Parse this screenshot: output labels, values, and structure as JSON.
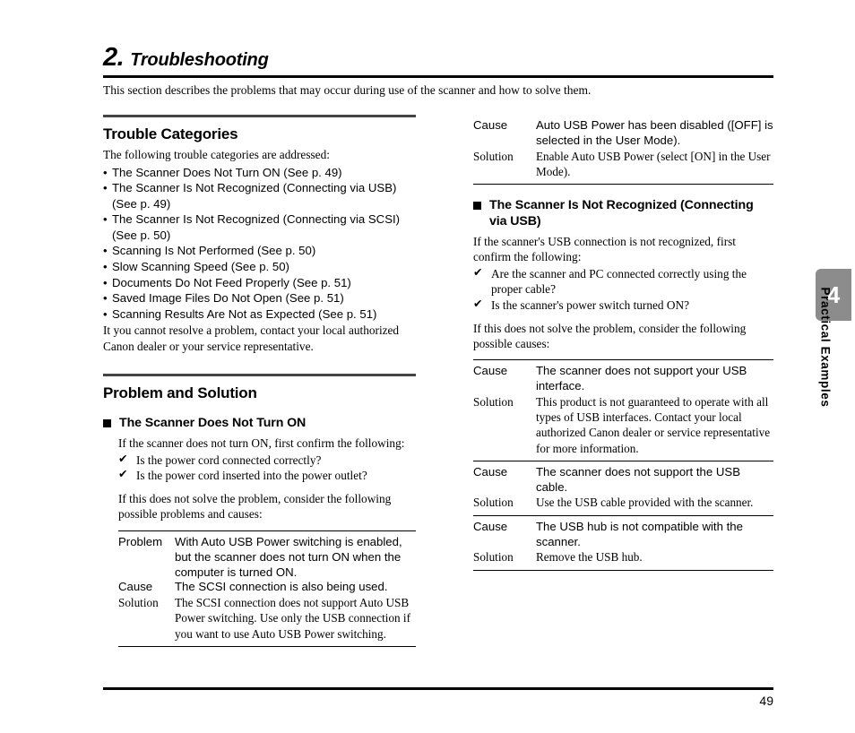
{
  "chapter": {
    "number": "2.",
    "title": "Troubleshooting",
    "intro": "This section describes the problems that may occur during use of the scanner and how to solve them."
  },
  "left_column": {
    "trouble_categories": {
      "heading": "Trouble Categories",
      "lead": "The following trouble categories are addressed:",
      "bullet_char": "•",
      "items": [
        "The Scanner Does Not Turn ON (See p. 49)",
        "The Scanner Is Not Recognized (Connecting via USB) (See p. 49)",
        "The Scanner Is Not Recognized (Connecting via SCSI) (See p. 50)",
        "Scanning Is Not Performed (See p. 50)",
        "Slow Scanning Speed (See p. 50)",
        "Documents Do Not Feed Properly (See p. 51)",
        "Saved Image Files Do Not Open (See p. 51)",
        "Scanning Results Are Not as Expected (See p. 51)"
      ],
      "closing": "It you cannot resolve a problem, contact your local authorized Canon dealer or your service representative."
    },
    "problem_and_solution": {
      "heading": "Problem and Solution",
      "subsection": {
        "title": "The Scanner Does Not Turn ON",
        "lead": "If the scanner does not turn ON, first confirm the following:",
        "check_char": "✔",
        "checks": [
          "Is the power cord connected correctly?",
          "Is the power cord inserted into the power outlet?"
        ],
        "followup": "If this does not solve the problem, consider the following possible problems and causes:",
        "table": [
          {
            "rows": [
              {
                "label": "Problem",
                "value": "With Auto USB Power switching is enabled, but the scanner does not turn ON when the computer is turned ON.",
                "style": "sans"
              },
              {
                "label": "Cause",
                "value": "The SCSI connection is also being used.",
                "style": "sans"
              },
              {
                "label": "Solution",
                "value": "The SCSI connection does not support Auto USB Power switching. Use only the USB connection if you want to use Auto USB Power switching.",
                "style": "serif"
              }
            ]
          }
        ]
      }
    }
  },
  "right_column": {
    "continued_table": [
      {
        "rows": [
          {
            "label": "Cause",
            "value": "Auto USB Power has been disabled ([OFF] is selected in the User Mode).",
            "style": "sans"
          },
          {
            "label": "Solution",
            "value": "Enable Auto USB Power (select [ON] in the User Mode).",
            "style": "serif"
          }
        ]
      }
    ],
    "subsection": {
      "title": "The Scanner Is Not Recognized (Connecting via USB)",
      "lead": "If the scanner's USB connection is not recognized, first confirm the following:",
      "check_char": "✔",
      "checks": [
        "Are the scanner and PC connected correctly using the proper cable?",
        "Is the scanner's power switch turned ON?"
      ],
      "followup": "If this does not solve the problem, consider the following possible causes:",
      "table": [
        {
          "rows": [
            {
              "label": "Cause",
              "value": "The scanner does not support your USB interface.",
              "style": "sans"
            },
            {
              "label": "Solution",
              "value": "This product is not guaranteed to operate with all types of USB interfaces. Contact your local authorized Canon dealer or service representative for more information.",
              "style": "serif"
            }
          ]
        },
        {
          "rows": [
            {
              "label": "Cause",
              "value": "The scanner does not support the USB cable.",
              "style": "sans"
            },
            {
              "label": "Solution",
              "value": "Use the USB cable provided with the scanner.",
              "style": "serif"
            }
          ]
        },
        {
          "rows": [
            {
              "label": "Cause",
              "value": "The USB hub is not compatible with the scanner.",
              "style": "sans"
            },
            {
              "label": "Solution",
              "value": "Remove the USB hub.",
              "style": "serif"
            }
          ]
        }
      ]
    }
  },
  "side_tab": {
    "number": "4",
    "label": "Practical Examples",
    "color": "#8c8c8c"
  },
  "footer": {
    "page_number": "49"
  }
}
